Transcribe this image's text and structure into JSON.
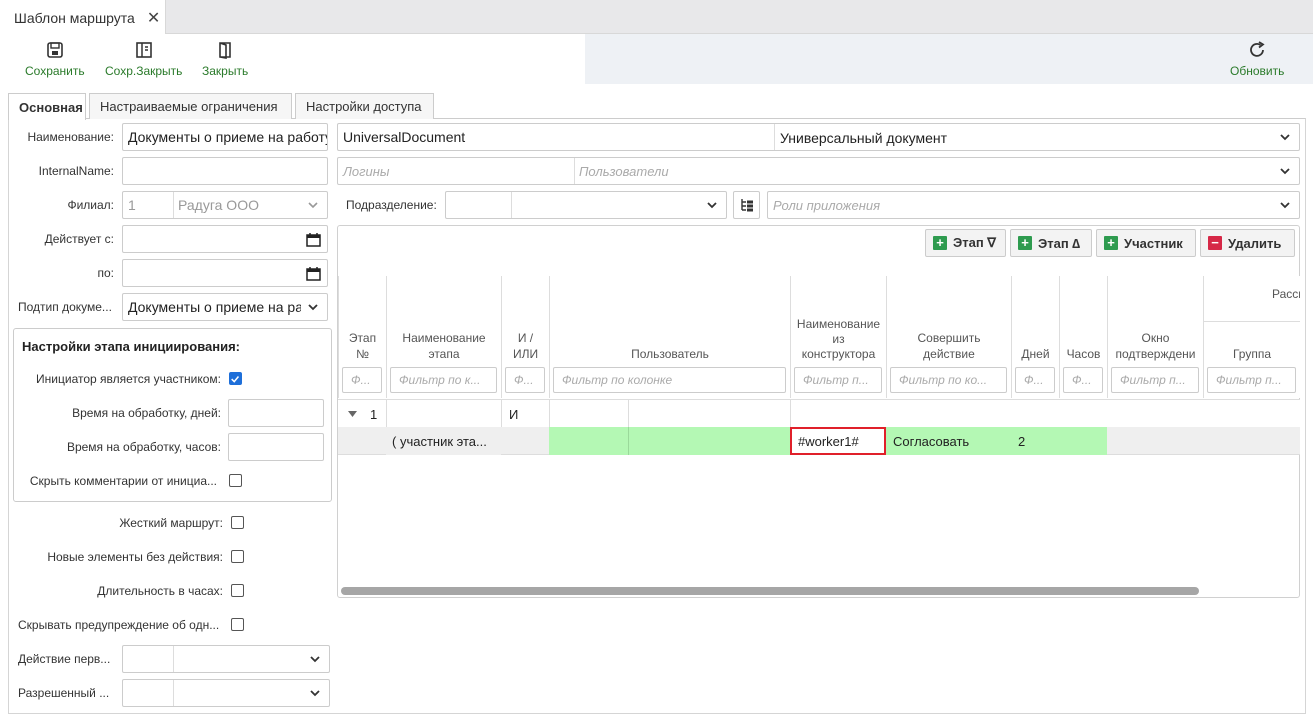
{
  "window_tab": {
    "title": "Шаблон маршрута",
    "close": "✕"
  },
  "toolbar": {
    "save": "Сохранить",
    "save_close": "Сохр.Закрыть",
    "close": "Закрыть",
    "refresh": "Обновить"
  },
  "form_tabs": [
    "Основная",
    "Настраиваемые ограничения",
    "Настройки доступа"
  ],
  "form": {
    "name_label": "Наименование:",
    "name_value": "Документы о приеме на работу",
    "internal_name_label": "InternalName:",
    "branch_label": "Филиал:",
    "branch_code": "1",
    "branch_name": "Радуга ООО",
    "valid_from_label": "Действует с:",
    "valid_to_label": "по:",
    "doc_subtype_label": "Подтип докуме...",
    "doc_subtype_value": "Документы о приеме на работу",
    "doc_type_code": "UniversalDocument",
    "doc_type_name": "Универсальный документ",
    "logins_placeholder": "Логины",
    "users_placeholder": "Пользователи",
    "department_label": "Подразделение:",
    "app_roles_placeholder": "Роли приложения"
  },
  "init_settings": {
    "title": "Настройки этапа инициирования:",
    "initiator_participant": "Инициатор является участником:",
    "time_days": "Время на обработку, дней:",
    "time_hours": "Время на обработку, часов:",
    "hide_comments": "Скрыть комментарии от инициа..."
  },
  "options": {
    "strict_route": "Жесткий маршрут:",
    "new_items_no_action": "Новые элементы без действия:",
    "duration_hours": "Длительность в часах:",
    "hide_warning": "Скрывать предупреждение об одн...",
    "first_action": "Действие перв...",
    "allowed": "Разрешенный ..."
  },
  "grid_buttons": {
    "stage_down": "Этап ∇",
    "stage_up": "Этап ∆",
    "participant": "Участник",
    "delete": "Удалить"
  },
  "grid_headers": {
    "stage_no_1": "Этап",
    "stage_no_2": "№",
    "stage_name_1": "Наименование",
    "stage_name_2": "этапа",
    "and_or_1": "И /",
    "and_or_2": "ИЛИ",
    "user": "Пользователь",
    "constructor_name_1": "Наименование",
    "constructor_name_2": "из",
    "constructor_name_3": "конструктора",
    "perform_action_1": "Совершить",
    "perform_action_2": "действие",
    "days": "Дней",
    "hours": "Часов",
    "confirm_window_1": "Окно",
    "confirm_window_2": "подтверждени",
    "group": "Группа",
    "distribution": "Рассы"
  },
  "filters": {
    "f1": "Ф...",
    "f2": "Фильтр по к...",
    "f3": "Ф...",
    "f4": "Фильтр по колонке",
    "f5": "Фильтр п...",
    "f6": "Фильтр по ко...",
    "f7": "Ф...",
    "f8": "Ф...",
    "f9": "Фильтр п...",
    "f10": "Фильтр п..."
  },
  "rows": {
    "group_no": "1",
    "group_andor": "И",
    "stage_name": "( участник эта...",
    "constructor_name": "#worker1#",
    "action": "Согласовать",
    "days": "2"
  },
  "colors": {
    "accent_green": "#2a7a2a",
    "row_green": "#b4f8b4",
    "highlight_red": "#e0202a"
  }
}
